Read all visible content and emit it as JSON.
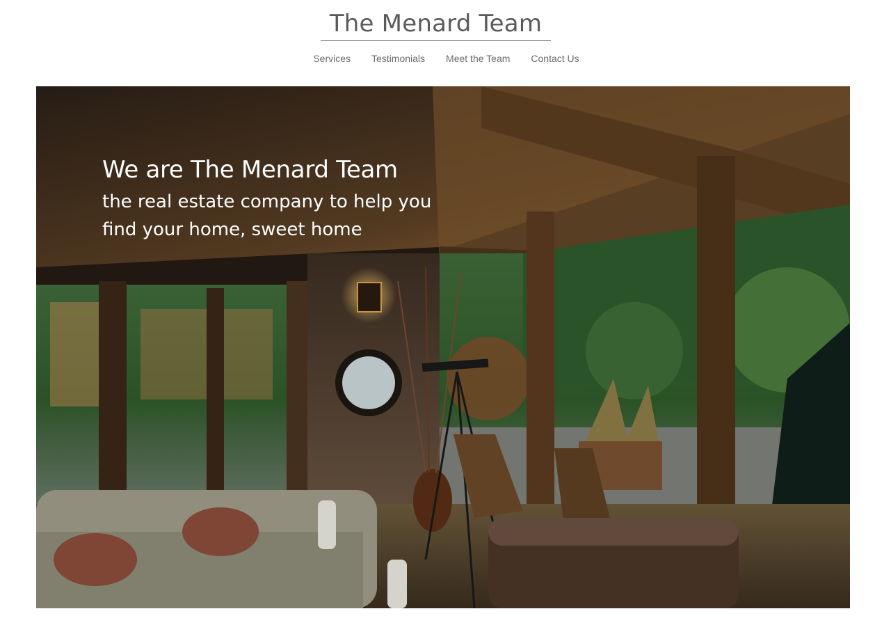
{
  "header": {
    "brand": "The Menard Team",
    "nav": [
      {
        "label": "Services"
      },
      {
        "label": "Testimonials"
      },
      {
        "label": "Meet the Team"
      },
      {
        "label": "Contact Us"
      }
    ]
  },
  "hero": {
    "title": "We are The Menard Team",
    "subtitle": "the real estate company to help you find your home, sweet home",
    "image": "living-room-photo"
  },
  "colors": {
    "brand_text": "#5a5a5a",
    "nav_text": "#6b6b6b",
    "hero_text": "#ffffff"
  }
}
